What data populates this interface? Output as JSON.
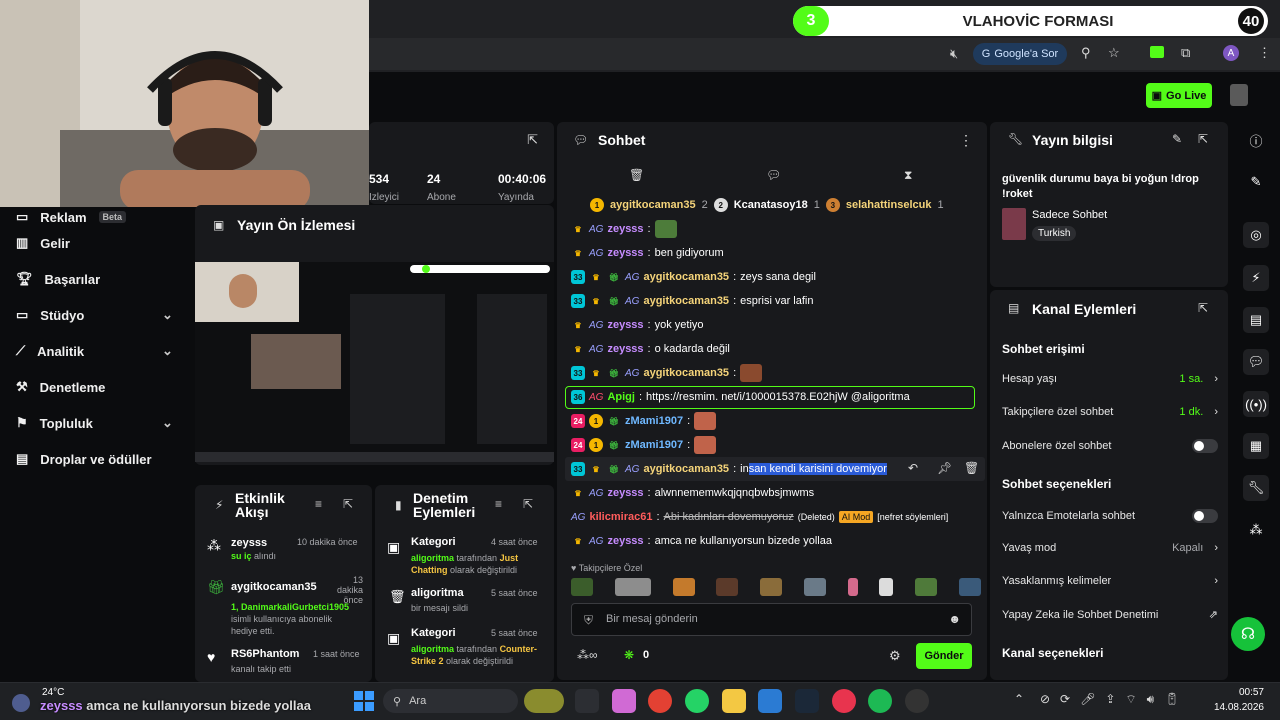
{
  "banner": {
    "number": "3",
    "title": "VLAHOVİC FORMASI",
    "count": "40"
  },
  "browser": {
    "google_button": "Google'a Sor",
    "profile_initial": "A"
  },
  "header": {
    "go_live": "Go Live"
  },
  "stats": {
    "viewers_partial": "534",
    "viewers_label_partial": "İzleyici",
    "subs": "24",
    "subs_label_partial": "Abone",
    "uptime": "00:40:06",
    "uptime_label_partial": "Yayında"
  },
  "sidebar": {
    "items": [
      {
        "label": "Reklam",
        "badge": "Beta"
      },
      {
        "label": "Gelir"
      },
      {
        "label": "Başarılar"
      },
      {
        "label": "Stüdyo"
      },
      {
        "label": "Analitik"
      },
      {
        "label": "Denetleme"
      },
      {
        "label": "Topluluk"
      },
      {
        "label": "Droplar ve ödüller"
      }
    ]
  },
  "preview": {
    "title": "Yayın Ön İzlemesi"
  },
  "activity": {
    "title": "Etkinlik Akışı",
    "items": [
      {
        "user": "zeysss",
        "time": "10 dakika önce",
        "detail": "su iç",
        "detail_suffix": " alındı"
      },
      {
        "user": "aygitkocaman35",
        "time": "13 dakika önce",
        "detail": "1, DanimarkaliGurbetci1905",
        "detail_suffix": " isimli kullanıcıya abonelik hediye etti."
      },
      {
        "user": "RS6Phantom",
        "time": "1 saat önce",
        "detail": "",
        "detail_suffix": "kanalı takip etti"
      }
    ]
  },
  "moderation": {
    "title": "Denetim Eylemleri",
    "items": [
      {
        "action": "Kategori",
        "time": "4 saat önce",
        "actor": "aligoritma",
        "mid": " tarafından ",
        "target": "Just Chatting",
        "suffix": " olarak değiştirildi"
      },
      {
        "action": "aligoritma",
        "time": "5 saat önce",
        "actor": "",
        "mid": "",
        "target": "",
        "suffix": "bir mesajı sildi"
      },
      {
        "action": "Kategori",
        "time": "5 saat önce",
        "actor": "aligoritma",
        "mid": " tarafından ",
        "target": "Counter-Strike 2",
        "suffix": " olarak değiştirildi"
      }
    ]
  },
  "chat": {
    "title": "Sohbet",
    "leaderboard": [
      {
        "rank": "1",
        "user": "aygitkocaman35",
        "count": "2"
      },
      {
        "rank": "2",
        "user": "Kcanatasoy18",
        "count": "1"
      },
      {
        "rank": "3",
        "user": "selahattinselcuk",
        "count": "1"
      }
    ],
    "messages": [
      {
        "user": "zeysss",
        "text": ""
      },
      {
        "user": "zeysss",
        "text": "ben gidiyorum"
      },
      {
        "user": "aygitkocaman35",
        "text": "zeys sana degil"
      },
      {
        "user": "aygitkocaman35",
        "text": "esprisi var lafin"
      },
      {
        "user": "zeysss",
        "text": "yok yetiyo"
      },
      {
        "user": "zeysss",
        "text": "o kadarda değil"
      },
      {
        "user": "aygitkocaman35",
        "text": ""
      },
      {
        "user": "Apigj",
        "text": "https://resmim. net/i/1000015378.E02hjW @aligoritma"
      },
      {
        "user": "zMami1907",
        "text": ""
      },
      {
        "user": "zMami1907",
        "text": ""
      },
      {
        "user": "aygitkocaman35",
        "text_plain": "in",
        "text_highlight": "san kendi karisini dovemiyor"
      },
      {
        "user": "zeysss",
        "text": "alwnnememwkqjqnqbwbsjmwms"
      },
      {
        "user": "kilicmirac61",
        "text": "Abi kadınları dovemuyoruz",
        "deleted": "(Deleted)",
        "ai_mod": "AI Mod",
        "reason": "[nefret söylemleri]"
      },
      {
        "user": "zeysss",
        "text": "amca ne kullanıyorsun bizede yollaa"
      }
    ],
    "badge_numbers": {
      "sub33": "33",
      "sub36": "36",
      "sub24": "24",
      "one": "1"
    },
    "followers_only": "Takipçilere Özel",
    "input_placeholder": "Bir mesaj gönderin",
    "points": "0",
    "send": "Gönder"
  },
  "stream_info": {
    "title": "Yayın bilgisi",
    "stream_title": "güvenlik durumu baya bi yoğun !drop !roket",
    "category": "Sadece Sohbet",
    "tag": "Turkish"
  },
  "channel_actions": {
    "title": "Kanal Eylemleri",
    "chat_access": "Sohbet erişimi",
    "rows": [
      {
        "label": "Hesap yaşı",
        "value": "1 sa."
      },
      {
        "label": "Takipçilere özel sohbet",
        "value": "1 dk."
      },
      {
        "label": "Abonelere özel sohbet",
        "value": ""
      }
    ],
    "chat_options": "Sohbet seçenekleri",
    "rows2": [
      {
        "label": "Yalnızca Emotelarla sohbet",
        "value": ""
      },
      {
        "label": "Yavaş mod",
        "value": "Kapalı"
      },
      {
        "label": "Yasaklanmış kelimeler",
        "value": ""
      },
      {
        "label": "Yapay Zeka ile Sohbet Denetimi",
        "value": ""
      }
    ],
    "channel_options": "Kanal seçenekleri"
  },
  "taskbar": {
    "temp": "24°C",
    "ticker_user": "zeysss",
    "ticker_text": "amca ne kullanıyorsun bizede yollaa",
    "search": "Ara",
    "time": "00:57",
    "date": "14.08.2026"
  },
  "colors": {
    "kick_green": "#53fc18",
    "bg": "#0b0c0e",
    "panel": "#18191c"
  }
}
